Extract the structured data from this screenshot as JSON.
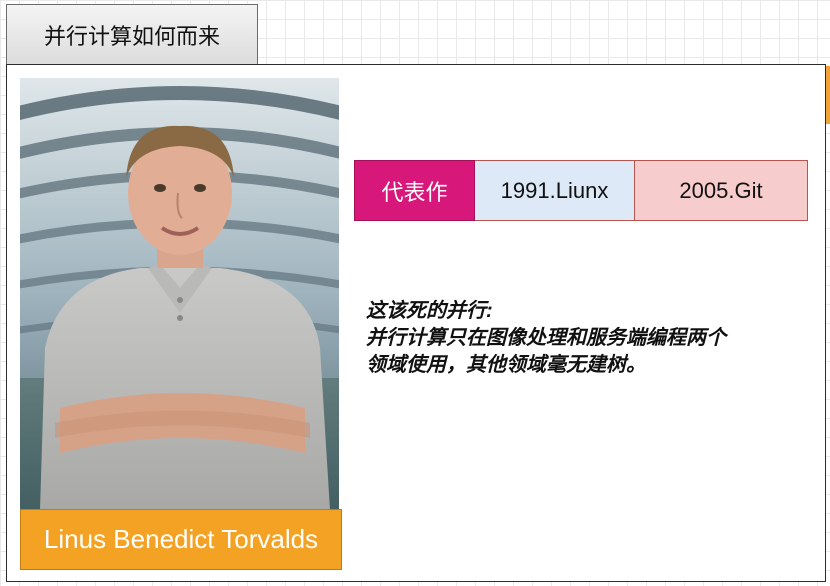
{
  "tab": {
    "title": "并行计算如何而来"
  },
  "person": {
    "name": "Linus Benedict Torvalds"
  },
  "works": {
    "label": "代表作",
    "items": [
      "1991.Liunx",
      "2005.Git"
    ]
  },
  "description": {
    "lines": [
      "这该死的并行:",
      "并行计算只在图像处理和服务端编程两个",
      "领域使用，其他领域毫无建树。"
    ]
  },
  "colors": {
    "accent_orange": "#f4a224",
    "label_magenta": "#d7177a",
    "work_blue": "#dde9f6",
    "work_pink": "#f7cccc"
  }
}
